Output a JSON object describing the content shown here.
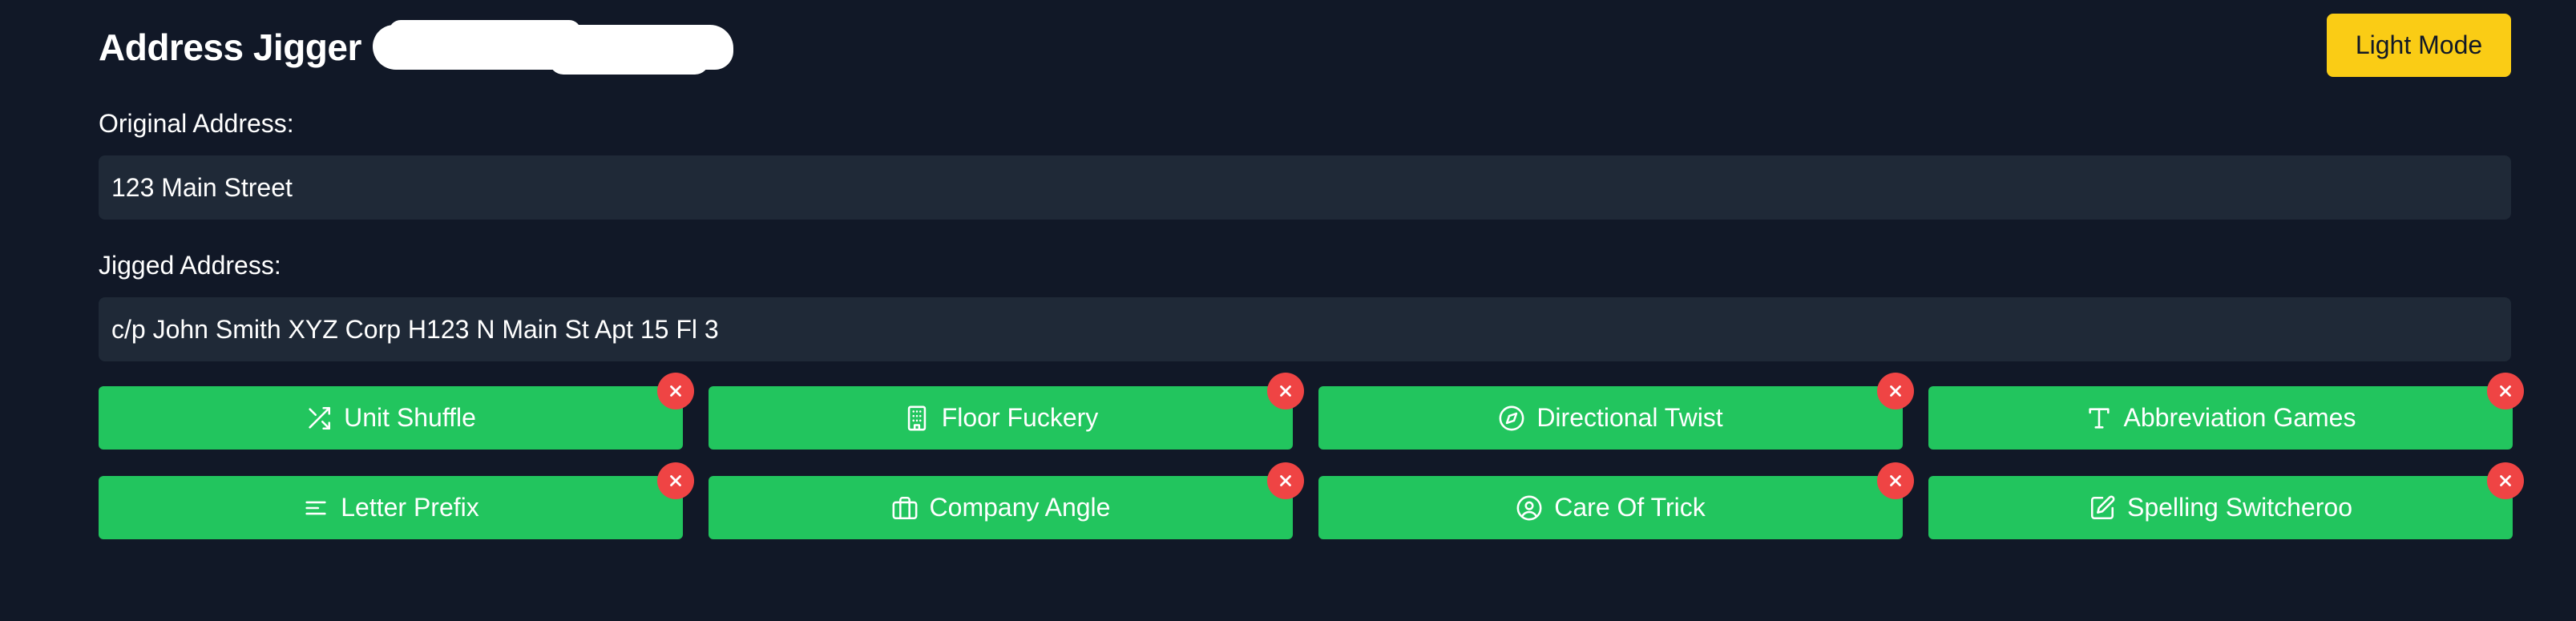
{
  "header": {
    "title": "Address Jigger",
    "mode_toggle_label": "Light Mode"
  },
  "original": {
    "label": "Original Address:",
    "value": "123 Main Street"
  },
  "jigged": {
    "label": "Jigged Address:",
    "value": "c/p John Smith XYZ Corp H123 N Main St Apt 15 Fl 3"
  },
  "techniques": [
    {
      "label": "Unit Shuffle",
      "icon": "shuffle-icon"
    },
    {
      "label": "Floor Fuckery",
      "icon": "building-icon"
    },
    {
      "label": "Directional Twist",
      "icon": "compass-icon"
    },
    {
      "label": "Abbreviation Games",
      "icon": "type-icon"
    },
    {
      "label": "Letter Prefix",
      "icon": "align-left-icon"
    },
    {
      "label": "Company Angle",
      "icon": "briefcase-icon"
    },
    {
      "label": "Care Of Trick",
      "icon": "user-circle-icon"
    },
    {
      "label": "Spelling Switcheroo",
      "icon": "edit-icon"
    }
  ],
  "colors": {
    "background": "#111827",
    "input_bg": "#1f2937",
    "accent_yellow": "#facc15",
    "technique_green": "#22c55e",
    "remove_red": "#ef4444"
  }
}
